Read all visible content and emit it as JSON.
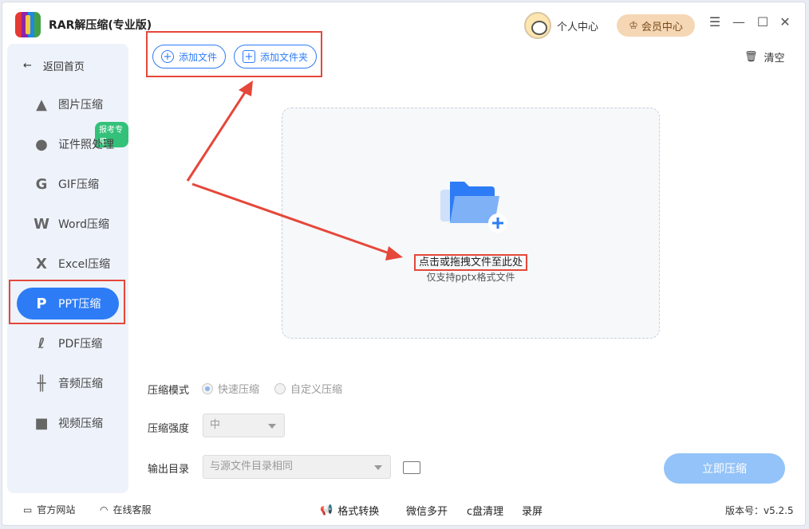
{
  "app": {
    "title": "RAR解压缩(专业版)"
  },
  "header": {
    "user_center": "个人中心",
    "vip_center": "会员中心"
  },
  "sidebar": {
    "back": "返回首页",
    "badge": "报考专用",
    "items": [
      {
        "label": "图片压缩",
        "icon": "image-icon"
      },
      {
        "label": "证件照处理",
        "icon": "id-photo-icon"
      },
      {
        "label": "GIF压缩",
        "icon": "gif-icon"
      },
      {
        "label": "Word压缩",
        "icon": "word-icon"
      },
      {
        "label": "Excel压缩",
        "icon": "excel-icon"
      },
      {
        "label": "PPT压缩",
        "icon": "ppt-icon"
      },
      {
        "label": "PDF压缩",
        "icon": "pdf-icon"
      },
      {
        "label": "音频压缩",
        "icon": "audio-icon"
      },
      {
        "label": "视频压缩",
        "icon": "video-icon"
      }
    ],
    "active_index": 5
  },
  "toolbar": {
    "add_file": "添加文件",
    "add_folder": "添加文件夹",
    "clear": "清空"
  },
  "dropzone": {
    "main": "点击或拖拽文件至此处",
    "sub": "仅支持pptx格式文件"
  },
  "settings": {
    "mode_label": "压缩模式",
    "mode_options": [
      "快速压缩",
      "自定义压缩"
    ],
    "mode_selected": "快速压缩",
    "strength_label": "压缩强度",
    "strength_value": "中",
    "output_label": "输出目录",
    "output_value": "与源文件目录相同",
    "start": "立即压缩"
  },
  "footer": {
    "website": "官方网站",
    "service": "在线客服",
    "format_convert": "格式转换",
    "wechat_multi": "微信多开",
    "c_clean": "c盘清理",
    "record": "录屏",
    "version": "版本号：v5.2.5"
  },
  "colors": {
    "accent": "#2d7cf6",
    "annotation": "#e5473a",
    "vip": "#f5d7b5"
  }
}
